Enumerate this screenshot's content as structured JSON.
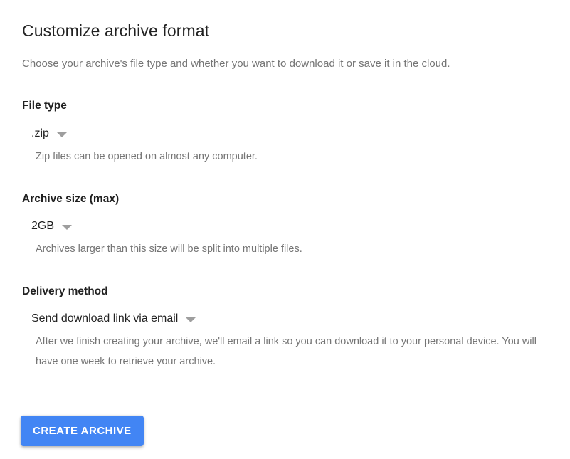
{
  "page": {
    "title": "Customize archive format",
    "subtitle": "Choose your archive's file type and whether you want to download it or save it in the cloud."
  },
  "sections": [
    {
      "label": "File type",
      "value": ".zip",
      "description": "Zip files can be opened on almost any computer."
    },
    {
      "label": "Archive size (max)",
      "value": "2GB",
      "description": "Archives larger than this size will be split into multiple files."
    },
    {
      "label": "Delivery method",
      "value": "Send download link via email",
      "description": "After we finish creating your archive, we'll email a link so you can download it to your personal device. You will have one week to retrieve your archive."
    }
  ],
  "button": {
    "label": "CREATE ARCHIVE"
  },
  "icons": {
    "dropdown_arrow": "chevron-down-icon"
  },
  "colors": {
    "accent": "#4285f4",
    "heading": "#212121",
    "muted": "#757575",
    "arrow": "#9e9e9e",
    "background": "#ffffff"
  }
}
